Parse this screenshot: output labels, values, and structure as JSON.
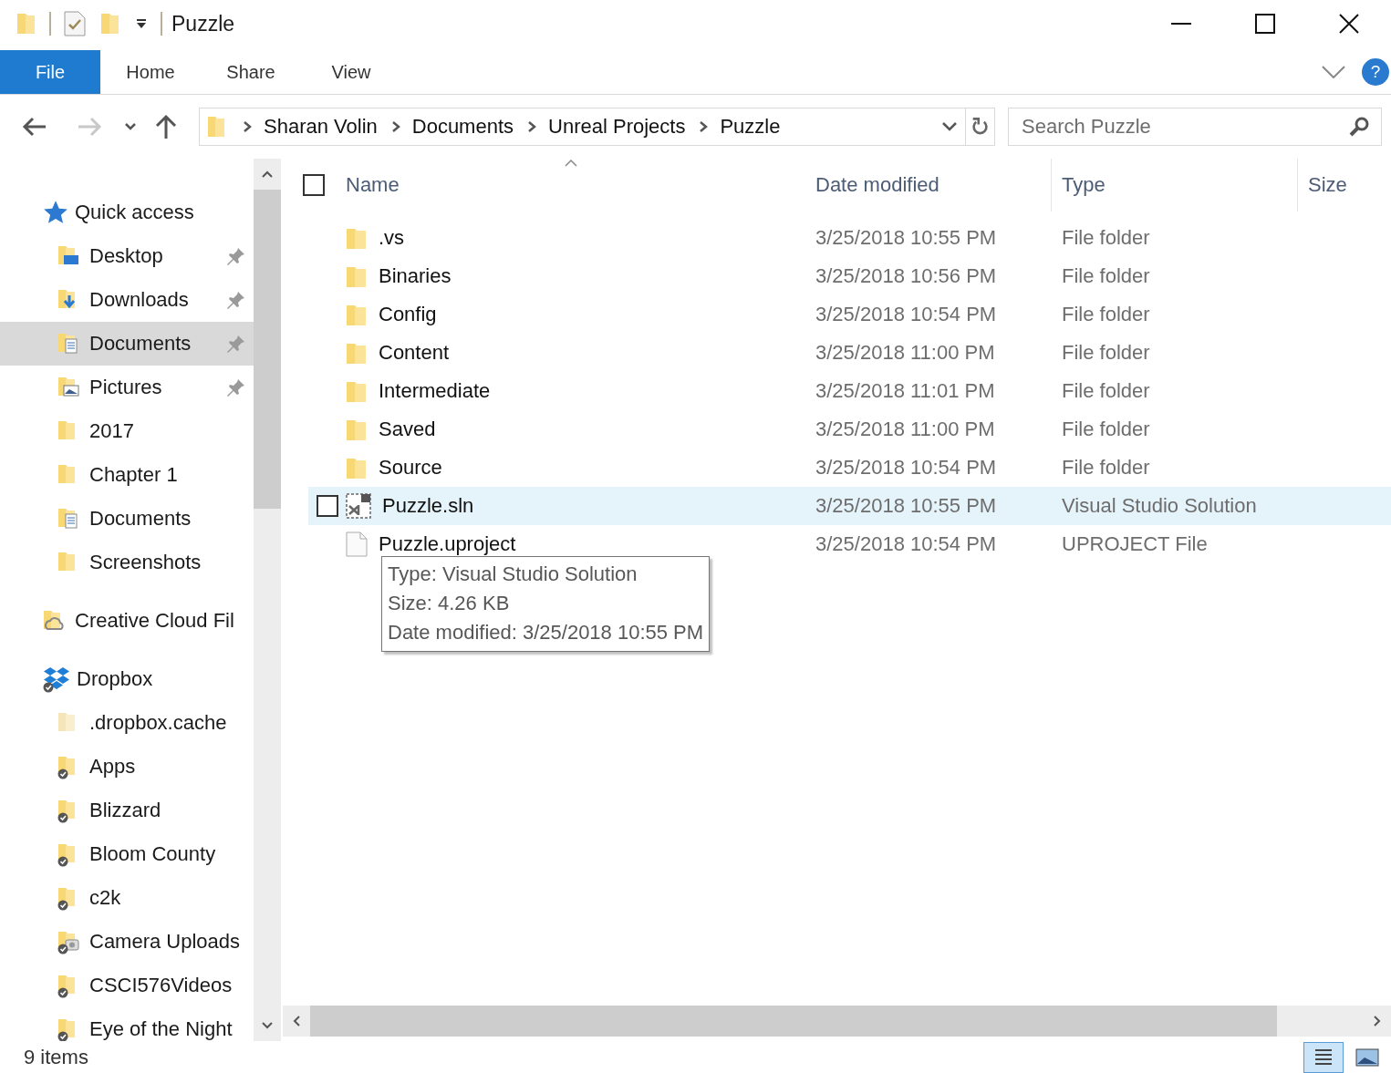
{
  "window": {
    "title": "Puzzle"
  },
  "ribbon_tabs": [
    {
      "label": "File",
      "selected": true
    },
    {
      "label": "Home",
      "selected": false
    },
    {
      "label": "Share",
      "selected": false
    },
    {
      "label": "View",
      "selected": false
    }
  ],
  "help": "?",
  "navigation": {
    "back_disabled": false,
    "forward_disabled": true
  },
  "select_all": {
    "checked": false
  },
  "address": {
    "crumbs": [
      "Sharan Volin",
      "Documents",
      "Unreal Projects",
      "Puzzle"
    ]
  },
  "search": {
    "placeholder": "Search Puzzle"
  },
  "nav_tree": [
    {
      "label": "Quick access",
      "kind": "quick-access",
      "selected": false,
      "children": [
        {
          "label": "Desktop",
          "kind": "desktop",
          "selected": false,
          "pinned": true
        },
        {
          "label": "Downloads",
          "kind": "downloads",
          "selected": false,
          "pinned": true
        },
        {
          "label": "Documents",
          "kind": "documents",
          "selected": true,
          "pinned": true
        },
        {
          "label": "Pictures",
          "kind": "pictures",
          "selected": false,
          "pinned": true
        },
        {
          "label": "2017",
          "kind": "folder",
          "selected": false,
          "pinned": false
        },
        {
          "label": "Chapter 1",
          "kind": "folder",
          "selected": false,
          "pinned": false
        },
        {
          "label": "Documents",
          "kind": "documents",
          "selected": false,
          "pinned": false
        },
        {
          "label": "Screenshots",
          "kind": "folder",
          "selected": false,
          "pinned": false
        }
      ]
    },
    {
      "label": "Creative Cloud Fil",
      "kind": "creative-cloud",
      "selected": false
    },
    {
      "label": "Dropbox",
      "kind": "dropbox",
      "selected": false,
      "children": [
        {
          "label": ".dropbox.cache",
          "kind": "hidden-folder",
          "selected": false,
          "synced": false
        },
        {
          "label": "Apps",
          "kind": "folder",
          "selected": false,
          "synced": true
        },
        {
          "label": "Blizzard",
          "kind": "folder",
          "selected": false,
          "synced": true
        },
        {
          "label": "Bloom County",
          "kind": "folder",
          "selected": false,
          "synced": true
        },
        {
          "label": "c2k",
          "kind": "folder",
          "selected": false,
          "synced": true
        },
        {
          "label": "Camera Uploads",
          "kind": "camera",
          "selected": false,
          "synced": true
        },
        {
          "label": "CSCI576Videos",
          "kind": "folder",
          "selected": false,
          "synced": true
        },
        {
          "label": "Eye of the Night",
          "kind": "folder",
          "selected": false,
          "synced": true
        }
      ]
    }
  ],
  "table": {
    "columns": [
      "Name",
      "Date modified",
      "Type",
      "Size"
    ],
    "rows": [
      {
        "name": ".vs",
        "date": "3/25/2018 10:55 PM",
        "type": "File folder",
        "kind": "folder",
        "selected": false
      },
      {
        "name": "Binaries",
        "date": "3/25/2018 10:56 PM",
        "type": "File folder",
        "kind": "folder",
        "selected": false
      },
      {
        "name": "Config",
        "date": "3/25/2018 10:54 PM",
        "type": "File folder",
        "kind": "folder",
        "selected": false
      },
      {
        "name": "Content",
        "date": "3/25/2018 11:00 PM",
        "type": "File folder",
        "kind": "folder",
        "selected": false
      },
      {
        "name": "Intermediate",
        "date": "3/25/2018 11:01 PM",
        "type": "File folder",
        "kind": "folder",
        "selected": false
      },
      {
        "name": "Saved",
        "date": "3/25/2018 11:00 PM",
        "type": "File folder",
        "kind": "folder",
        "selected": false
      },
      {
        "name": "Source",
        "date": "3/25/2018 10:54 PM",
        "type": "File folder",
        "kind": "folder",
        "selected": false
      },
      {
        "name": "Puzzle.sln",
        "date": "3/25/2018 10:55 PM",
        "type": "Visual Studio Solution",
        "kind": "solution",
        "selected": true
      },
      {
        "name": "Puzzle.uproject",
        "date": "3/25/2018 10:54 PM",
        "type": "UPROJECT File",
        "kind": "file",
        "selected": false
      }
    ]
  },
  "tooltip": [
    "Type: Visual Studio Solution",
    "Size: 4.26 KB",
    "Date modified: 3/25/2018 10:55 PM"
  ],
  "status_bar": {
    "text": "9 items",
    "views": [
      {
        "kind": "details",
        "selected": true
      },
      {
        "kind": "large-icons",
        "selected": false
      }
    ]
  }
}
